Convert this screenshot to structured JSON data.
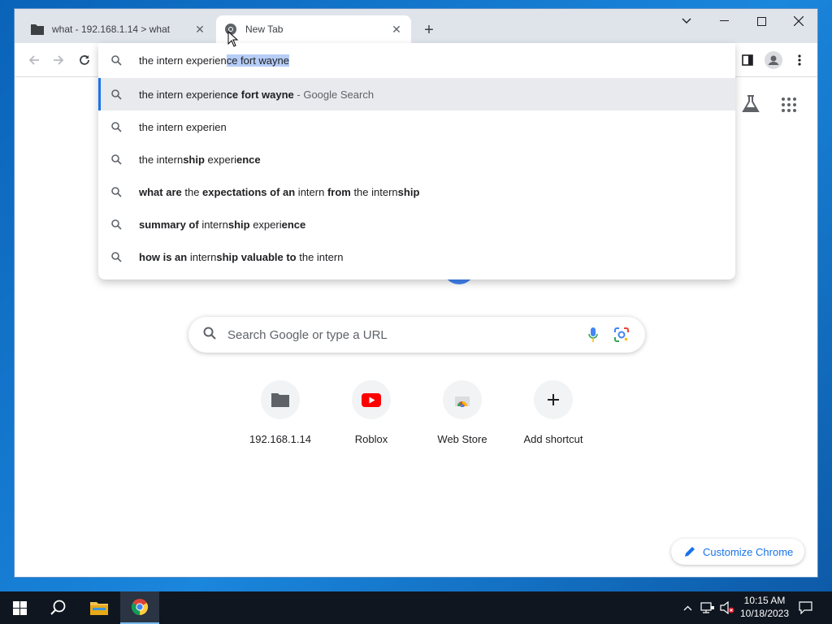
{
  "tabs": [
    {
      "title": "what - 192.168.1.14 > what",
      "icon": "folder-icon",
      "active": false
    },
    {
      "title": "New Tab",
      "icon": "chrome-icon",
      "active": true
    }
  ],
  "omnibox": {
    "typed": "the intern experien",
    "autocomplete": "ce fort wayne"
  },
  "suggestions": [
    {
      "parts": [
        {
          "t": "the intern experien",
          "b": false
        },
        {
          "t": "ce fort wayne",
          "b": true
        }
      ],
      "meta": " - Google Search"
    },
    {
      "parts": [
        {
          "t": "the intern experien",
          "b": false
        }
      ]
    },
    {
      "parts": [
        {
          "t": "the intern",
          "b": false
        },
        {
          "t": "ship",
          "b": true
        },
        {
          "t": " experi",
          "b": false
        },
        {
          "t": "ence",
          "b": true
        }
      ]
    },
    {
      "parts": [
        {
          "t": "what are",
          "b": true
        },
        {
          "t": " the ",
          "b": false
        },
        {
          "t": "expectations of an",
          "b": true
        },
        {
          "t": " intern ",
          "b": false
        },
        {
          "t": "from",
          "b": true
        },
        {
          "t": " the intern",
          "b": false
        },
        {
          "t": "ship",
          "b": true
        }
      ]
    },
    {
      "parts": [
        {
          "t": "summary of",
          "b": true
        },
        {
          "t": " intern",
          "b": false
        },
        {
          "t": "ship",
          "b": true
        },
        {
          "t": " experi",
          "b": false
        },
        {
          "t": "ence",
          "b": true
        }
      ]
    },
    {
      "parts": [
        {
          "t": "how is an",
          "b": true
        },
        {
          "t": " intern",
          "b": false
        },
        {
          "t": "ship valuable to",
          "b": true
        },
        {
          "t": " the intern",
          "b": false
        }
      ]
    }
  ],
  "ntp": {
    "search_placeholder": "Search Google or type a URL",
    "shortcuts": [
      {
        "label": "192.168.1.14",
        "icon": "folder-icon"
      },
      {
        "label": "Roblox",
        "icon": "youtube-icon"
      },
      {
        "label": "Web Store",
        "icon": "webstore-icon"
      },
      {
        "label": "Add shortcut",
        "icon": "plus-icon"
      }
    ],
    "customize_label": "Customize Chrome"
  },
  "taskbar": {
    "time": "10:15 AM",
    "date": "10/18/2023"
  },
  "colors": {
    "accent": "#1a73e8",
    "selection": "#b6cdf7",
    "youtube_red": "#ff0000"
  }
}
